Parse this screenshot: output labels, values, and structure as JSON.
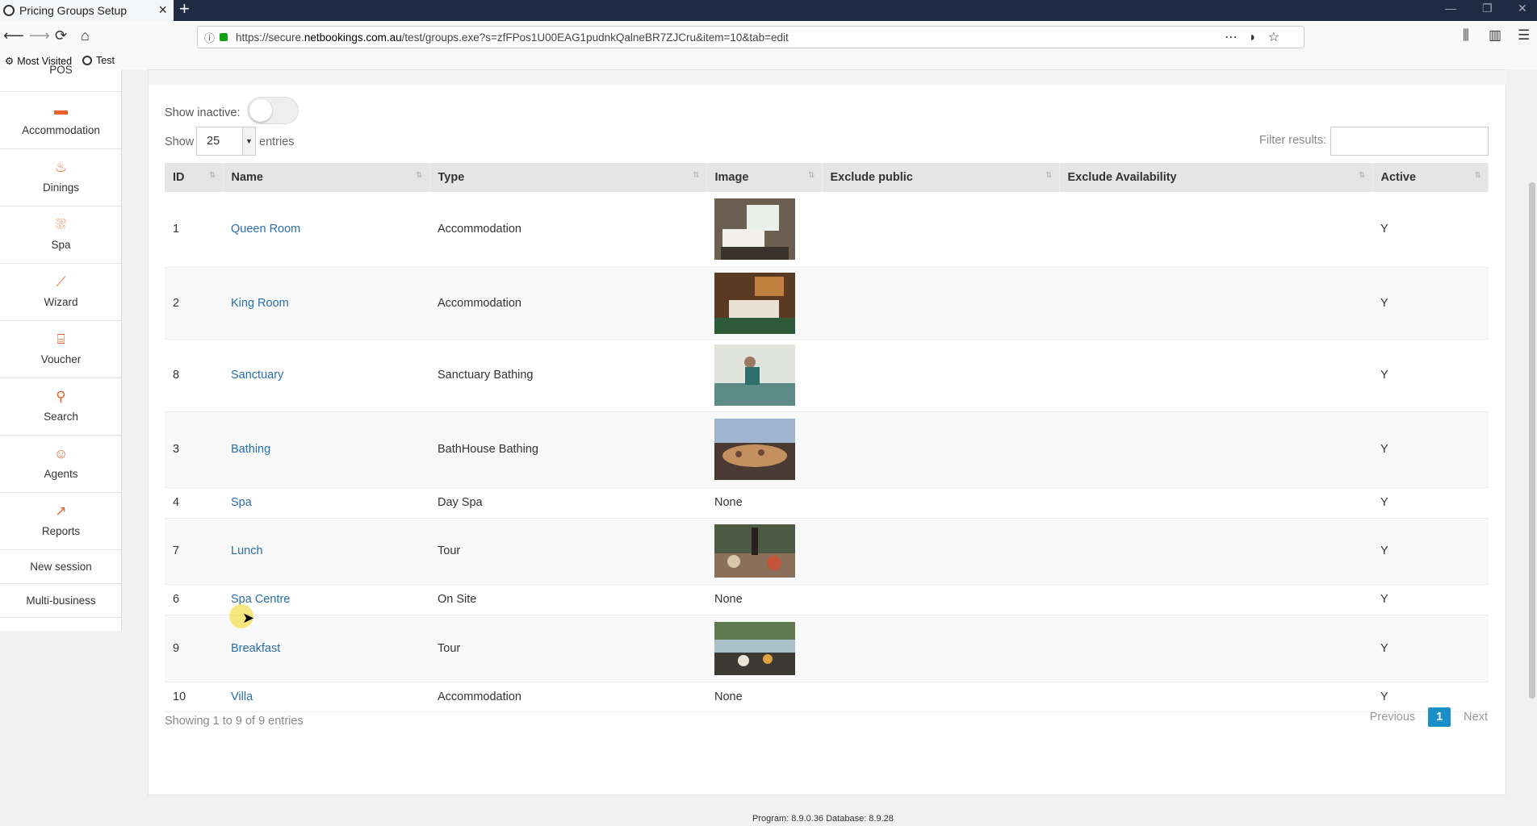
{
  "browser": {
    "tab_title": "Pricing Groups Setup",
    "url_prefix": "https://secure.",
    "url_domain": "netbookings.com.au",
    "url_rest": "/test/groups.exe?s=zfFPos1U00EAG1pudnkQalneBR7ZJCru&item=10&tab=edit",
    "bookmarks": [
      "Most Visited",
      "Test"
    ]
  },
  "sidebar": {
    "items": [
      {
        "label": "POS",
        "icon": "pos-icon"
      },
      {
        "label": "Accommodation",
        "icon": "bed-icon"
      },
      {
        "label": "Dinings",
        "icon": "dining-icon"
      },
      {
        "label": "Spa",
        "icon": "spa-icon"
      },
      {
        "label": "Wizard",
        "icon": "wand-icon"
      },
      {
        "label": "Voucher",
        "icon": "gift-icon"
      },
      {
        "label": "Search",
        "icon": "search-icon"
      },
      {
        "label": "Agents",
        "icon": "agent-icon"
      },
      {
        "label": "Reports",
        "icon": "chart-icon"
      }
    ],
    "links": [
      "New session",
      "Multi-business"
    ]
  },
  "controls": {
    "show_inactive_label": "Show inactive:",
    "show_label": "Show",
    "page_size": "25",
    "entries_label": "entries",
    "filter_label": "Filter results:",
    "filter_value": ""
  },
  "table": {
    "headers": [
      "ID",
      "Name",
      "Type",
      "Image",
      "Exclude public",
      "Exclude Availability",
      "Active"
    ],
    "rows": [
      {
        "id": "1",
        "name": "Queen Room",
        "type": "Accommodation",
        "image": "room",
        "active": "Y"
      },
      {
        "id": "2",
        "name": "King Room",
        "type": "Accommodation",
        "image": "room2",
        "active": "Y"
      },
      {
        "id": "8",
        "name": "Sanctuary",
        "type": "Sanctuary Bathing",
        "image": "pool",
        "active": "Y"
      },
      {
        "id": "3",
        "name": "Bathing",
        "type": "BathHouse Bathing",
        "image": "bath",
        "active": "Y"
      },
      {
        "id": "4",
        "name": "Spa",
        "type": "Day Spa",
        "image": "None",
        "active": "Y"
      },
      {
        "id": "7",
        "name": "Lunch",
        "type": "Tour",
        "image": "lunch",
        "active": "Y"
      },
      {
        "id": "6",
        "name": "Spa Centre",
        "type": "On Site",
        "image": "None",
        "active": "Y"
      },
      {
        "id": "9",
        "name": "Breakfast",
        "type": "Tour",
        "image": "breakfast",
        "active": "Y"
      },
      {
        "id": "10",
        "name": "Villa",
        "type": "Accommodation",
        "image": "None",
        "active": "Y"
      }
    ]
  },
  "pagination": {
    "info": "Showing 1 to 9 of 9 entries",
    "previous": "Previous",
    "current": "1",
    "next": "Next"
  },
  "footer": {
    "version": "Program: 8.9.0.36 Database: 8.9.28"
  },
  "colors": {
    "accent": "#e8622a",
    "link": "#2a6ead",
    "page_button": "#1a8fc7"
  }
}
